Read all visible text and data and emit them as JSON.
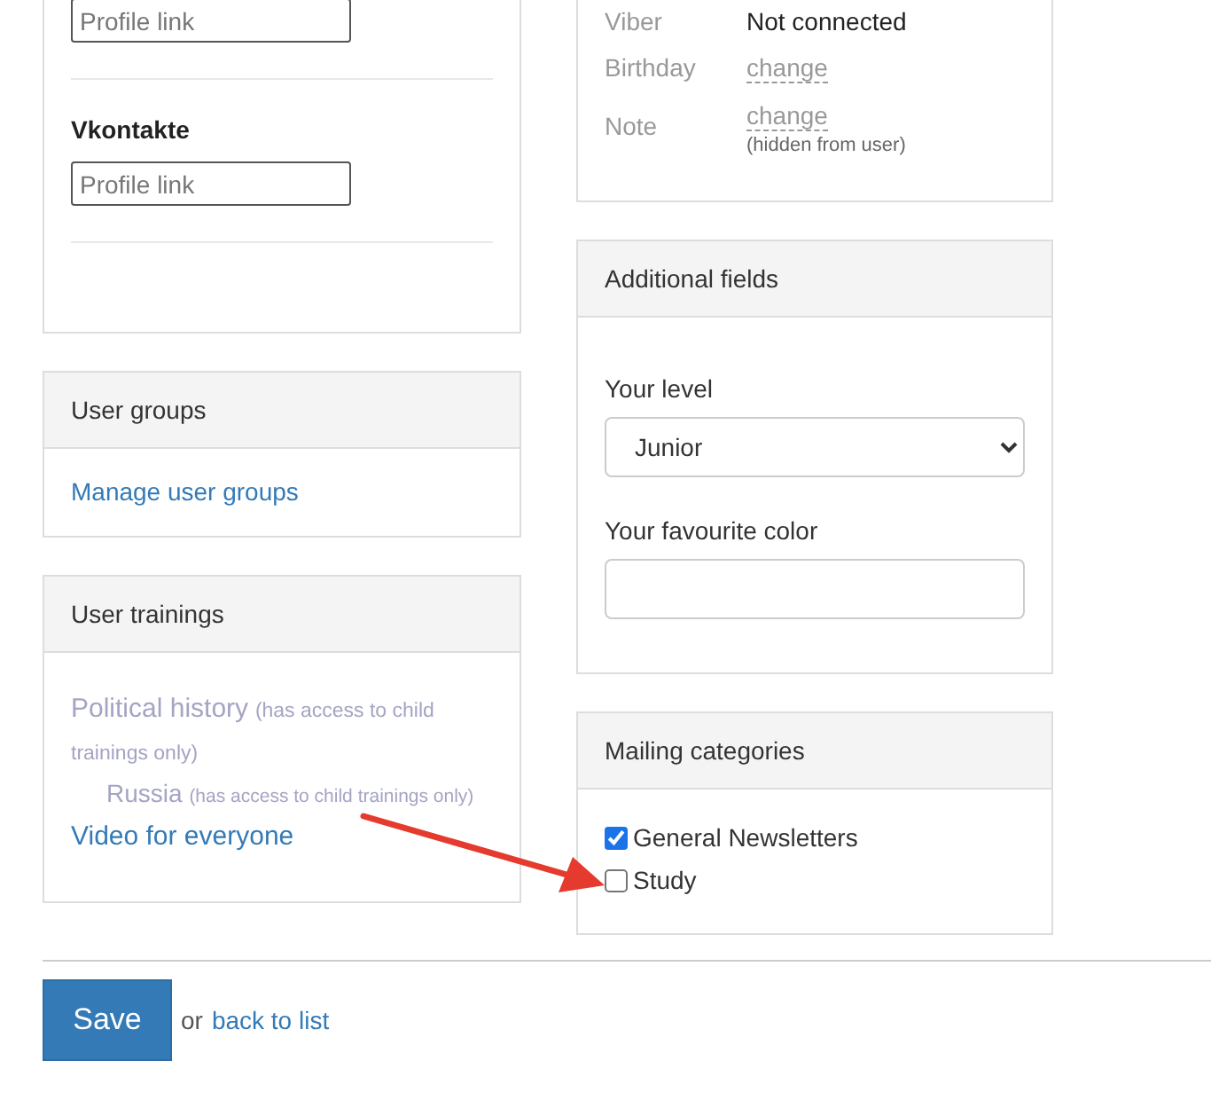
{
  "social_card": {
    "fields": [
      {
        "placeholder": "Profile link"
      },
      {
        "label": "Vkontakte",
        "placeholder": "Profile link"
      }
    ]
  },
  "user_groups": {
    "title": "User groups",
    "link": "Manage user groups"
  },
  "user_trainings": {
    "title": "User trainings",
    "items": [
      {
        "name": "Political history",
        "note": "(has access to child trainings only)",
        "available": false,
        "children": [
          {
            "name": "Russia",
            "note": "(has access to child trainings only)",
            "available": false
          }
        ]
      },
      {
        "name": "Video for everyone",
        "available": true
      }
    ]
  },
  "contact_card": {
    "rows": [
      {
        "label": "Viber",
        "kind": "text",
        "value": "Not connected"
      },
      {
        "label": "Birthday",
        "kind": "link",
        "value": "change"
      },
      {
        "label": "Note",
        "kind": "link",
        "value": "change",
        "hint": "(hidden from user)"
      }
    ]
  },
  "additional_fields": {
    "title": "Additional fields",
    "fields": [
      {
        "label": "Your level",
        "kind": "select",
        "value": "Junior"
      },
      {
        "label": "Your favourite color",
        "kind": "text"
      }
    ]
  },
  "mailing": {
    "title": "Mailing categories",
    "options": [
      {
        "label": "General Newsletters",
        "checked": true
      },
      {
        "label": "Study",
        "checked": false
      }
    ]
  },
  "footer": {
    "save": "Save",
    "or": "or",
    "back": "back to list"
  }
}
